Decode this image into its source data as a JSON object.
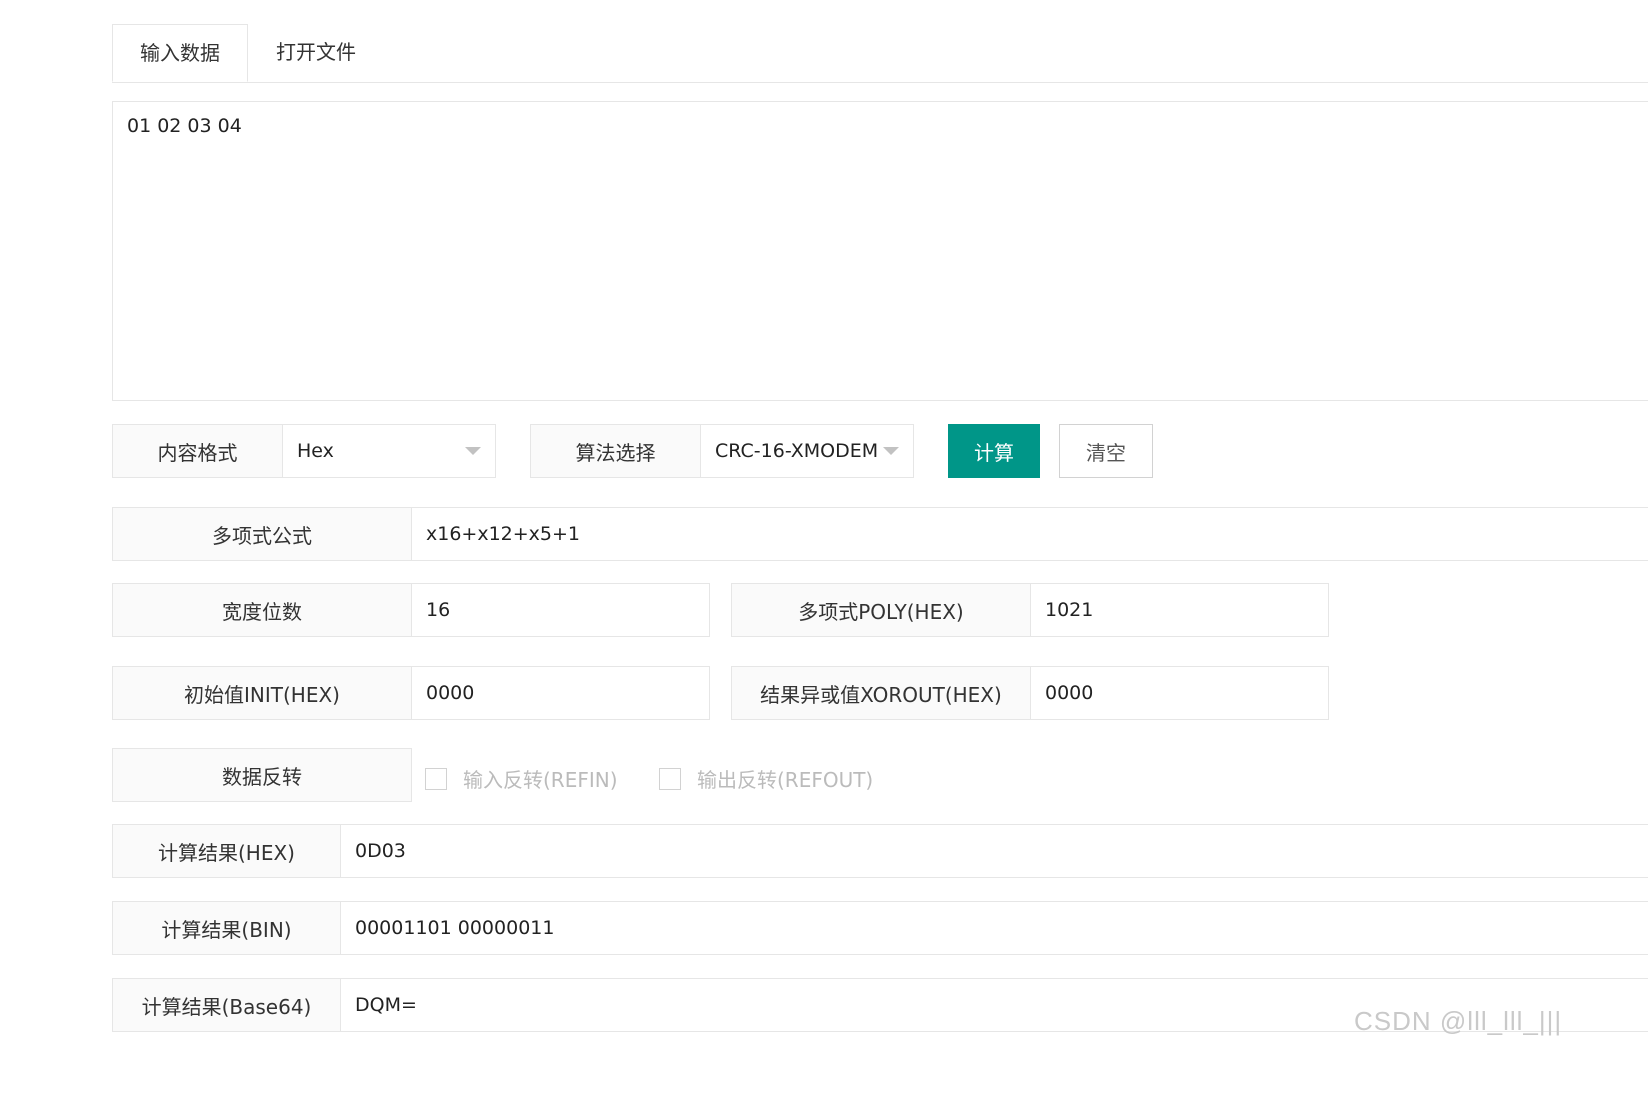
{
  "tabs": [
    {
      "label": "输入数据",
      "active": true
    },
    {
      "label": "打开文件",
      "active": false
    }
  ],
  "input_text": "01 02 03 04",
  "content_format": {
    "label": "内容格式",
    "value": "Hex"
  },
  "algorithm": {
    "label": "算法选择",
    "value": "CRC-16-XMODEM"
  },
  "buttons": {
    "calculate": "计算",
    "clear": "清空"
  },
  "polynomial_formula": {
    "label": "多项式公式",
    "value": "x16+x12+x5+1"
  },
  "width_bits": {
    "label": "宽度位数",
    "value": "16"
  },
  "poly_hex": {
    "label": "多项式POLY(HEX)",
    "value": "1021"
  },
  "init_hex": {
    "label": "初始值INIT(HEX)",
    "value": "0000"
  },
  "xorout_hex": {
    "label": "结果异或值XOROUT(HEX)",
    "value": "0000"
  },
  "data_reverse": {
    "label": "数据反转",
    "refin": {
      "label": "输入反转(REFIN)",
      "checked": false
    },
    "refout": {
      "label": "输出反转(REFOUT)",
      "checked": false
    }
  },
  "result_hex": {
    "label": "计算结果(HEX)",
    "value": "0D03"
  },
  "result_bin": {
    "label": "计算结果(BIN)",
    "value": "00001101 00000011"
  },
  "result_base64": {
    "label": "计算结果(Base64)",
    "value": "DQM="
  },
  "watermark": "CSDN @lll_lll_|||",
  "colors": {
    "primary": "#009688",
    "border": "#e6e6e6",
    "label_bg": "#fafafa"
  }
}
